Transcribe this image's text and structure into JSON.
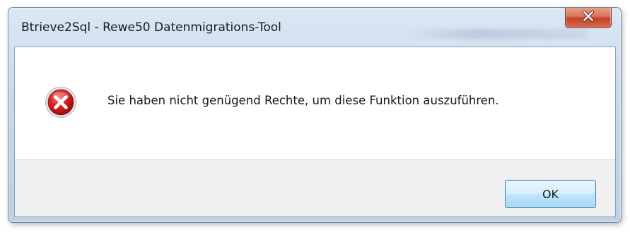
{
  "window": {
    "title": "Btrieve2Sql - Rewe50 Datenmigrations-Tool",
    "close_icon": "close-icon"
  },
  "dialog": {
    "icon": "error-icon",
    "message": "Sie haben nicht genügend Rechte, um diese Funktion auszuführen.",
    "ok_label": "OK"
  },
  "colors": {
    "close_button": "#c64325",
    "error_icon": "#d42020",
    "ok_button_border": "#3c7fb1"
  }
}
